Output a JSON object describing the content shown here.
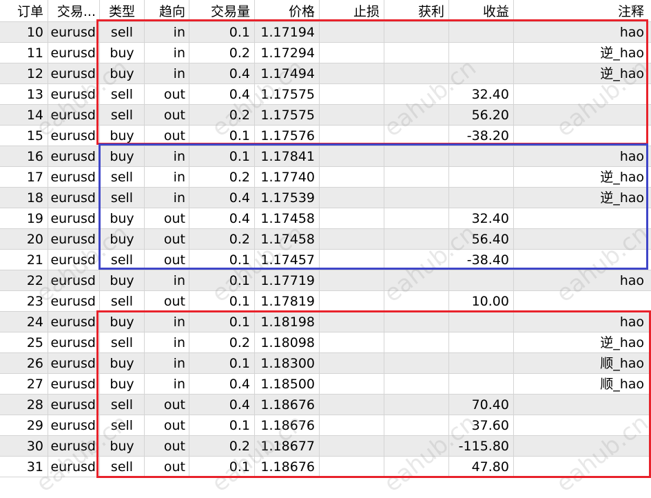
{
  "columns": [
    "订单",
    "交易...",
    "类型",
    "趋向",
    "交易量",
    "价格",
    "止损",
    "获利",
    "收益",
    "注释"
  ],
  "rows": [
    {
      "order": "10",
      "symbol": "eurusd",
      "type": "sell",
      "direction": "in",
      "volume": "0.1",
      "price": "1.17194",
      "sl": "",
      "tp": "",
      "profit": "",
      "comment": "hao"
    },
    {
      "order": "11",
      "symbol": "eurusd",
      "type": "buy",
      "direction": "in",
      "volume": "0.2",
      "price": "1.17294",
      "sl": "",
      "tp": "",
      "profit": "",
      "comment": "逆_hao"
    },
    {
      "order": "12",
      "symbol": "eurusd",
      "type": "buy",
      "direction": "in",
      "volume": "0.4",
      "price": "1.17494",
      "sl": "",
      "tp": "",
      "profit": "",
      "comment": "逆_hao"
    },
    {
      "order": "13",
      "symbol": "eurusd",
      "type": "sell",
      "direction": "out",
      "volume": "0.4",
      "price": "1.17575",
      "sl": "",
      "tp": "",
      "profit": "32.40",
      "comment": ""
    },
    {
      "order": "14",
      "symbol": "eurusd",
      "type": "sell",
      "direction": "out",
      "volume": "0.2",
      "price": "1.17575",
      "sl": "",
      "tp": "",
      "profit": "56.20",
      "comment": ""
    },
    {
      "order": "15",
      "symbol": "eurusd",
      "type": "buy",
      "direction": "out",
      "volume": "0.1",
      "price": "1.17576",
      "sl": "",
      "tp": "",
      "profit": "-38.20",
      "comment": ""
    },
    {
      "order": "16",
      "symbol": "eurusd",
      "type": "buy",
      "direction": "in",
      "volume": "0.1",
      "price": "1.17841",
      "sl": "",
      "tp": "",
      "profit": "",
      "comment": "hao"
    },
    {
      "order": "17",
      "symbol": "eurusd",
      "type": "sell",
      "direction": "in",
      "volume": "0.2",
      "price": "1.17740",
      "sl": "",
      "tp": "",
      "profit": "",
      "comment": "逆_hao"
    },
    {
      "order": "18",
      "symbol": "eurusd",
      "type": "sell",
      "direction": "in",
      "volume": "0.4",
      "price": "1.17539",
      "sl": "",
      "tp": "",
      "profit": "",
      "comment": "逆_hao"
    },
    {
      "order": "19",
      "symbol": "eurusd",
      "type": "buy",
      "direction": "out",
      "volume": "0.4",
      "price": "1.17458",
      "sl": "",
      "tp": "",
      "profit": "32.40",
      "comment": ""
    },
    {
      "order": "20",
      "symbol": "eurusd",
      "type": "buy",
      "direction": "out",
      "volume": "0.2",
      "price": "1.17458",
      "sl": "",
      "tp": "",
      "profit": "56.40",
      "comment": ""
    },
    {
      "order": "21",
      "symbol": "eurusd",
      "type": "sell",
      "direction": "out",
      "volume": "0.1",
      "price": "1.17457",
      "sl": "",
      "tp": "",
      "profit": "-38.40",
      "comment": ""
    },
    {
      "order": "22",
      "symbol": "eurusd",
      "type": "buy",
      "direction": "in",
      "volume": "0.1",
      "price": "1.17719",
      "sl": "",
      "tp": "",
      "profit": "",
      "comment": "hao"
    },
    {
      "order": "23",
      "symbol": "eurusd",
      "type": "sell",
      "direction": "out",
      "volume": "0.1",
      "price": "1.17819",
      "sl": "",
      "tp": "",
      "profit": "10.00",
      "comment": ""
    },
    {
      "order": "24",
      "symbol": "eurusd",
      "type": "buy",
      "direction": "in",
      "volume": "0.1",
      "price": "1.18198",
      "sl": "",
      "tp": "",
      "profit": "",
      "comment": "hao"
    },
    {
      "order": "25",
      "symbol": "eurusd",
      "type": "sell",
      "direction": "in",
      "volume": "0.2",
      "price": "1.18098",
      "sl": "",
      "tp": "",
      "profit": "",
      "comment": "逆_hao"
    },
    {
      "order": "26",
      "symbol": "eurusd",
      "type": "buy",
      "direction": "in",
      "volume": "0.1",
      "price": "1.18300",
      "sl": "",
      "tp": "",
      "profit": "",
      "comment": "顺_hao"
    },
    {
      "order": "27",
      "symbol": "eurusd",
      "type": "buy",
      "direction": "in",
      "volume": "0.4",
      "price": "1.18500",
      "sl": "",
      "tp": "",
      "profit": "",
      "comment": "顺_hao"
    },
    {
      "order": "28",
      "symbol": "eurusd",
      "type": "sell",
      "direction": "out",
      "volume": "0.4",
      "price": "1.18676",
      "sl": "",
      "tp": "",
      "profit": "70.40",
      "comment": ""
    },
    {
      "order": "29",
      "symbol": "eurusd",
      "type": "sell",
      "direction": "out",
      "volume": "0.1",
      "price": "1.18676",
      "sl": "",
      "tp": "",
      "profit": "37.60",
      "comment": ""
    },
    {
      "order": "30",
      "symbol": "eurusd",
      "type": "buy",
      "direction": "out",
      "volume": "0.2",
      "price": "1.18677",
      "sl": "",
      "tp": "",
      "profit": "-115.80",
      "comment": ""
    },
    {
      "order": "31",
      "symbol": "eurusd",
      "type": "sell",
      "direction": "out",
      "volume": "0.1",
      "price": "1.18676",
      "sl": "",
      "tp": "",
      "profit": "47.80",
      "comment": ""
    }
  ],
  "highlight_colors": {
    "group_a": "#e8222b",
    "group_b": "#3e45c8",
    "group_c": "#e8222b"
  },
  "stripe_color": "#ebebeb",
  "watermark": "eahub.cn"
}
